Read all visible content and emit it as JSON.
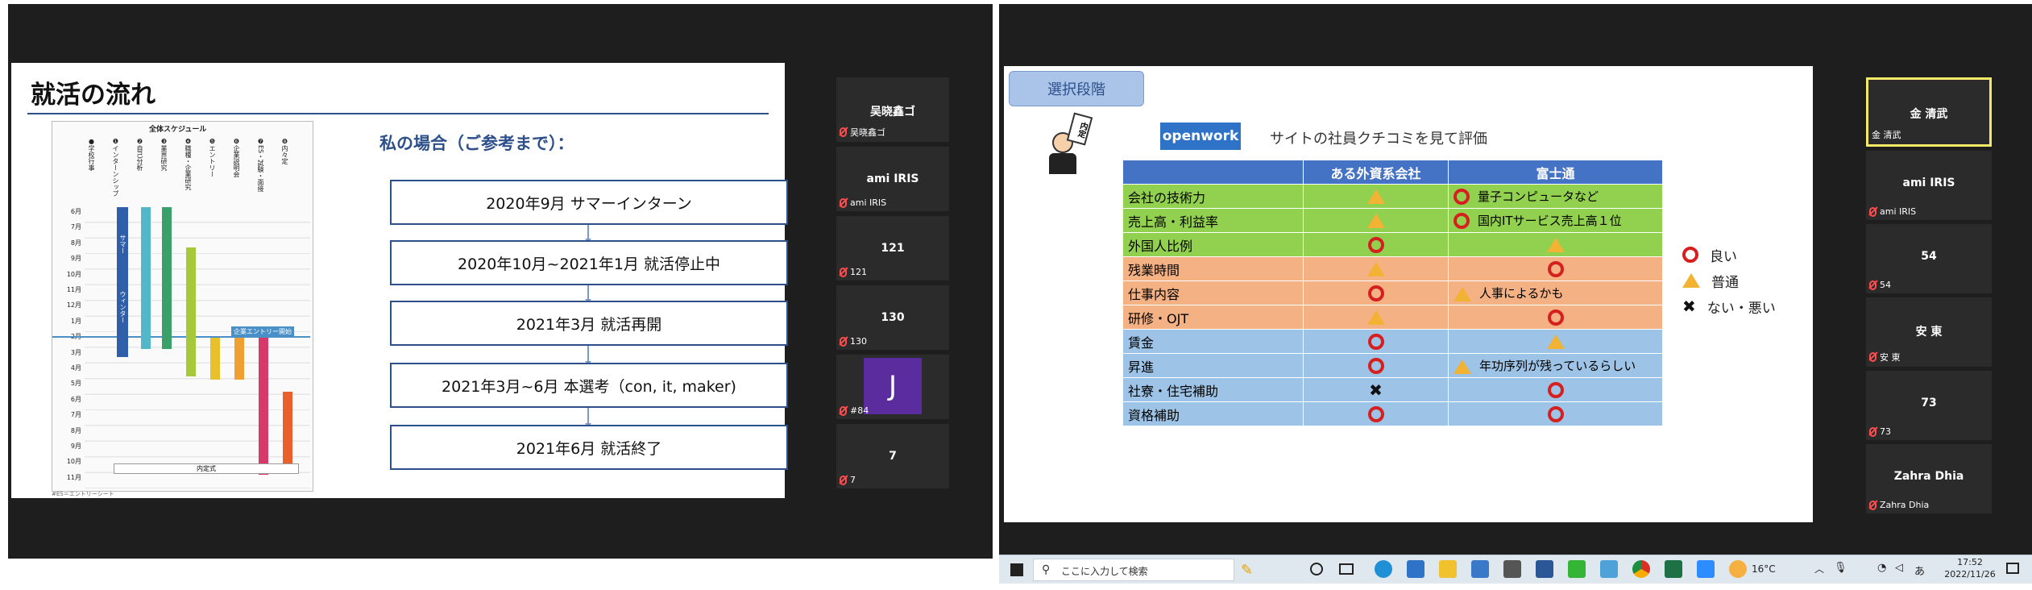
{
  "left_slide": {
    "title": "就活の流れ",
    "schedule_caption": "全体スケジュール",
    "schedule_columns": [
      "●学校行事",
      "❶インターンシップ",
      "❷自己分析",
      "❸業界研究",
      "❹職種・企業研究",
      "❺エントリー",
      "❻企業説明会",
      "❼ES・試験・面接",
      "❽内々定"
    ],
    "schedule_months": [
      "6月",
      "7月",
      "8月",
      "9月",
      "10月",
      "11月",
      "12月",
      "1月",
      "2月",
      "3月",
      "4月",
      "5月",
      "6月",
      "7月",
      "8月",
      "9月",
      "10月",
      "11月"
    ],
    "schedule_labels": {
      "summer": "サマー",
      "winter": "ウィンター",
      "entry_start": "企業エントリー開始",
      "naiteishiki": "内定式",
      "footnote": "#ES＝エントリーシート"
    },
    "case_heading": "私の場合（ご参考まで）：",
    "flow_steps": [
      "2020年9月 サマーインターン",
      "2020年10月~2021年1月  就活停止中",
      "2021年3月  就活再開",
      "2021年3月~6月 本選考（con, it, maker)",
      "2021年6月  就活終了"
    ]
  },
  "left_participants": [
    {
      "display": "吴晓鑫ゴ",
      "label": "吴晓鑫ゴ"
    },
    {
      "display": "ami IRIS",
      "label": "ami IRIS"
    },
    {
      "display": "121",
      "label": "121"
    },
    {
      "display": "130",
      "label": "130"
    },
    {
      "display": "J",
      "label": "#84",
      "avatar_color": "#5b2c9e"
    },
    {
      "display": "7",
      "label": "7"
    }
  ],
  "right_slide": {
    "stage_button": "選択段階",
    "poster_text": "内定",
    "openwork_logo": "openwork",
    "subtitle": "サイトの社員クチコミを見て評価",
    "table": {
      "headers": [
        "",
        "ある外資系会社",
        "富士通"
      ],
      "rows": [
        {
          "item": "会社の技術力",
          "a": "tri",
          "b": "circ",
          "b_note": "量子コンピュータなど",
          "color": "#92d050"
        },
        {
          "item": "売上高・利益率",
          "a": "tri",
          "b": "circ",
          "b_note": "国内ITサービス売上高１位",
          "color": "#92d050"
        },
        {
          "item": "外国人比例",
          "a": "circ",
          "b": "tri",
          "b_note": "",
          "color": "#92d050"
        },
        {
          "item": "残業時間",
          "a": "tri",
          "b": "circ",
          "b_note": "",
          "color": "#f4b183"
        },
        {
          "item": "仕事内容",
          "a": "circ",
          "b": "tri",
          "b_note": "人事によるかも",
          "color": "#f4b183"
        },
        {
          "item": "研修・OJT",
          "a": "tri",
          "b": "circ",
          "b_note": "",
          "color": "#f4b183"
        },
        {
          "item": "賃金",
          "a": "circ",
          "b": "tri",
          "b_note": "",
          "color": "#9dc3e6"
        },
        {
          "item": "昇進",
          "a": "circ",
          "b": "tri",
          "b_note": "年功序列が残っているらしい",
          "color": "#9dc3e6"
        },
        {
          "item": "社寮・住宅補助",
          "a": "cross",
          "b": "circ",
          "b_note": "",
          "color": "#9dc3e6"
        },
        {
          "item": "資格補助",
          "a": "circ",
          "b": "circ",
          "b_note": "",
          "color": "#9dc3e6"
        }
      ]
    },
    "legend": [
      {
        "symbol": "circ",
        "label": "良い"
      },
      {
        "symbol": "tri",
        "label": "普通"
      },
      {
        "symbol": "cross",
        "label": "ない・悪い"
      }
    ]
  },
  "right_participants": [
    {
      "display": "金 清武",
      "label": "金 清武",
      "active": true
    },
    {
      "display": "ami IRIS",
      "label": "ami IRIS"
    },
    {
      "display": "54",
      "label": "54"
    },
    {
      "display": "安 東",
      "label": "安 東"
    },
    {
      "display": "73",
      "label": "73"
    },
    {
      "display": "Zahra Dhia",
      "label": "Zahra Dhia"
    }
  ],
  "taskbar": {
    "search_placeholder": "ここに入力して検索",
    "weather": "16°C",
    "ime": "あ",
    "time": "17:52",
    "date": "2022/11/26"
  }
}
